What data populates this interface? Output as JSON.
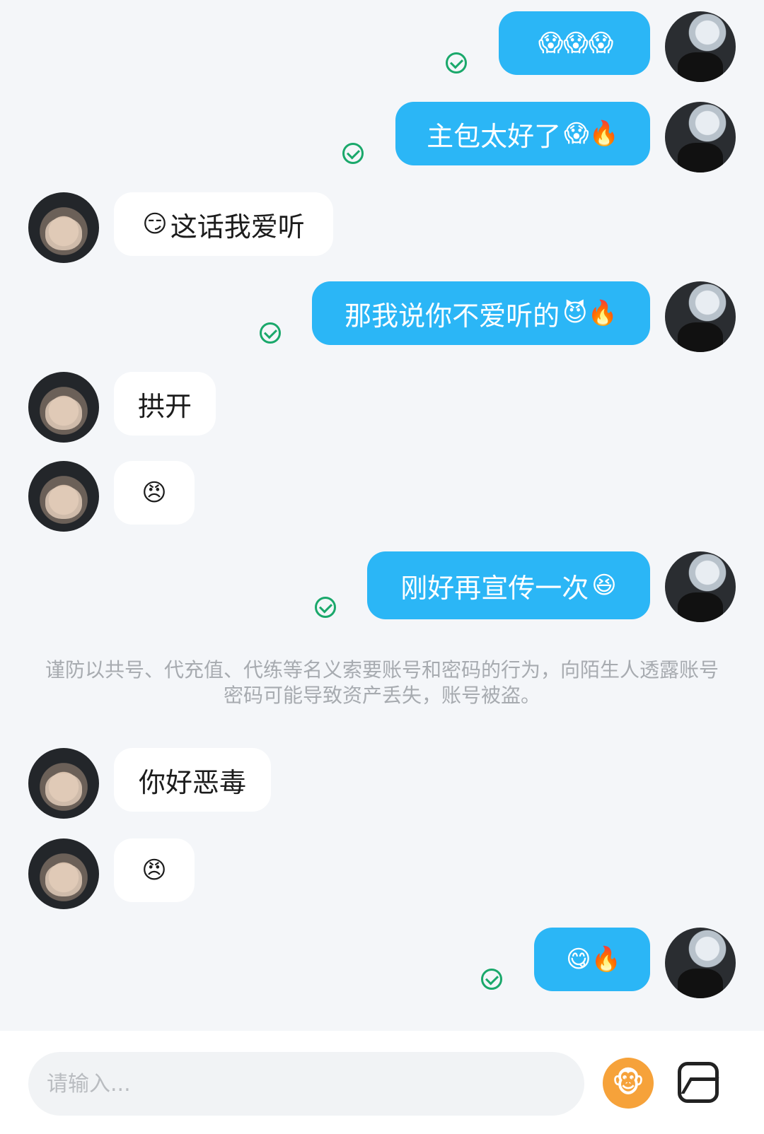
{
  "messages": [
    {
      "side": "me",
      "text": "",
      "emoji": "😱😱😱"
    },
    {
      "side": "me",
      "text": "主包太好了",
      "emoji": "😱🔥"
    },
    {
      "side": "peer",
      "text": "这话我爱听",
      "emoji_prefix": "😏"
    },
    {
      "side": "me",
      "text": "那我说你不爱听的",
      "emoji": "😈🔥"
    },
    {
      "side": "peer",
      "text": "拱开"
    },
    {
      "side": "peer",
      "text": "",
      "emoji": "😠"
    },
    {
      "side": "me",
      "text": "刚好再宣传一次",
      "emoji": "😆"
    },
    {
      "side": "peer",
      "text": "你好恶毒"
    },
    {
      "side": "peer",
      "text": "",
      "emoji": "😠"
    },
    {
      "side": "me",
      "text": "",
      "emoji": "😋🔥"
    }
  ],
  "notice": "谨防以共号、代充值、代练等名义索要账号和密码的行为，向陌生人透露账号密码可能导致资产丢失，账号被盗。",
  "composer": {
    "placeholder": "请输入...",
    "emoji_button_icon": "monkey-emoji-icon",
    "image_button_icon": "image-icon"
  },
  "colors": {
    "my_bubble": "#2bb6f6",
    "peer_bubble": "#ffffff",
    "background": "#f4f6f9",
    "sent_check": "#1aa86b"
  }
}
